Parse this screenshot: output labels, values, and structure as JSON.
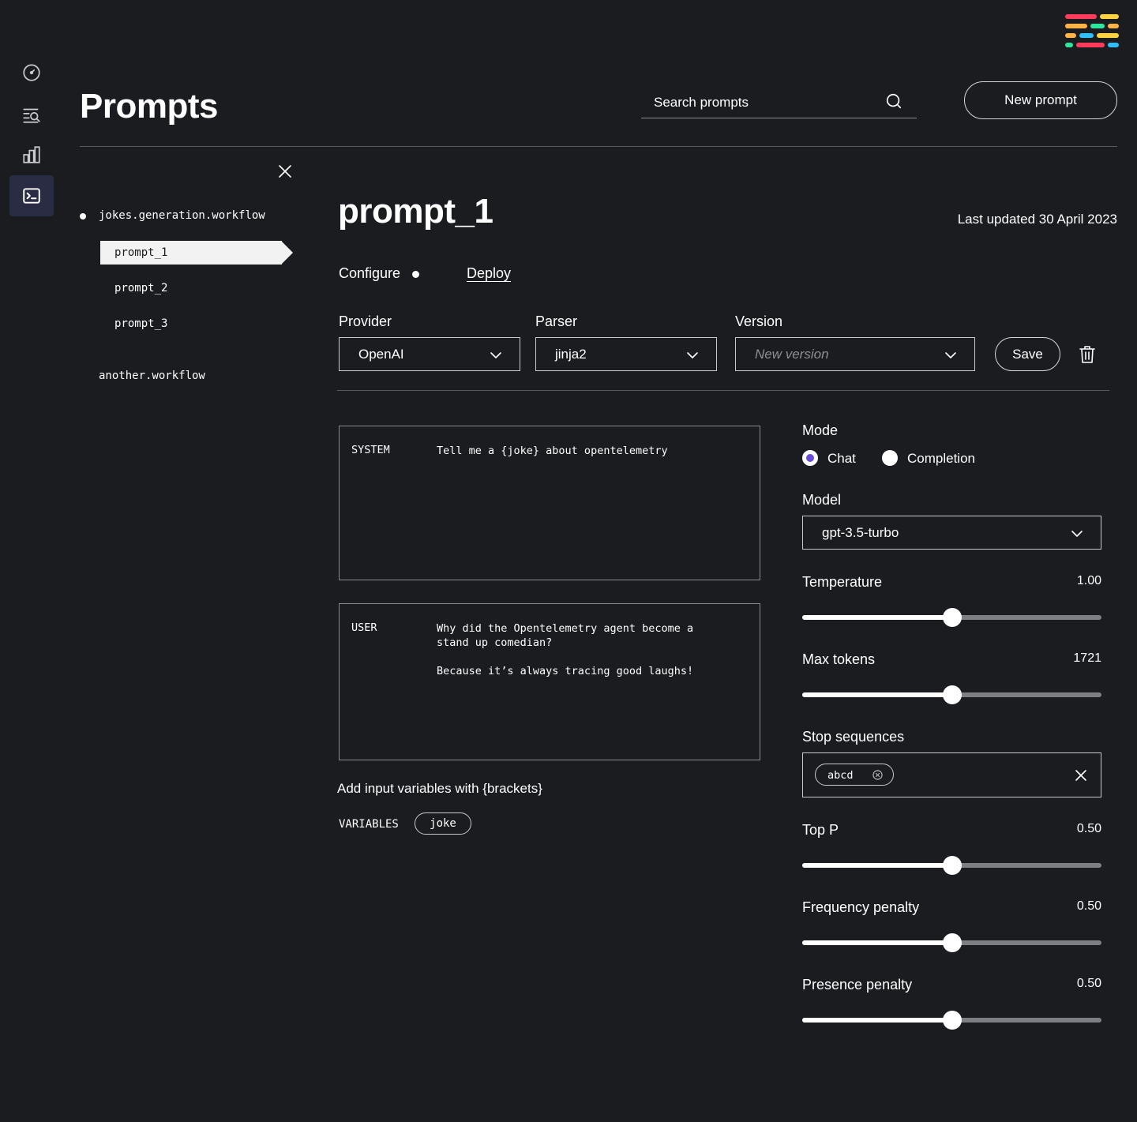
{
  "header": {
    "title": "Prompts",
    "search_placeholder": "Search prompts",
    "new_prompt_label": "New prompt"
  },
  "rail": {
    "icons": [
      "dashboard-icon",
      "search-list-icon",
      "bar-chart-icon",
      "terminal-icon"
    ],
    "active": "terminal-icon"
  },
  "sidebar": {
    "workflows": [
      {
        "name": "jokes.generation.workflow",
        "prompts": [
          "prompt_1",
          "prompt_2",
          "prompt_3"
        ],
        "selected": "prompt_1"
      },
      {
        "name": "another.workflow"
      }
    ]
  },
  "prompt": {
    "name": "prompt_1",
    "last_updated": "Last updated 30 April 2023",
    "tabs": {
      "configure": "Configure",
      "deploy": "Deploy"
    }
  },
  "config": {
    "provider_label": "Provider",
    "provider_value": "OpenAI",
    "parser_label": "Parser",
    "parser_value": "jinja2",
    "version_label": "Version",
    "version_placeholder": "New version",
    "save_label": "Save"
  },
  "messages": [
    {
      "role": "SYSTEM",
      "text": "Tell me a {joke} about opentelemetry"
    },
    {
      "role": "USER",
      "text": "Why did the Opentelemetry agent become a\nstand up comedian?\n\nBecause it’s always tracing good laughs!"
    }
  ],
  "variables": {
    "hint": "Add input variables with {brackets}",
    "label": "VARIABLES",
    "items": [
      "joke"
    ]
  },
  "settings": {
    "mode_label": "Mode",
    "mode_options": [
      "Chat",
      "Completion"
    ],
    "mode_selected": "Chat",
    "model_label": "Model",
    "model_value": "gpt-3.5-turbo",
    "temperature": {
      "label": "Temperature",
      "value": "1.00",
      "fraction": 0.5
    },
    "max_tokens": {
      "label": "Max tokens",
      "value": "1721",
      "fraction": 0.5
    },
    "stop_sequences_label": "Stop sequences",
    "stop_sequences": [
      "abcd"
    ],
    "top_p": {
      "label": "Top P",
      "value": "0.50",
      "fraction": 0.5
    },
    "frequency_penalty": {
      "label": "Frequency penalty",
      "value": "0.50",
      "fraction": 0.5
    },
    "presence_penalty": {
      "label": "Presence penalty",
      "value": "0.50",
      "fraction": 0.5
    }
  },
  "colors": {
    "background": "#1b1c20",
    "accent": "#6a4cd8",
    "rail_active": "#2a2c43",
    "logo": [
      "#ff3b5c",
      "#ffd23f",
      "#ffb347",
      "#2ee59d",
      "#2fbfff"
    ]
  }
}
